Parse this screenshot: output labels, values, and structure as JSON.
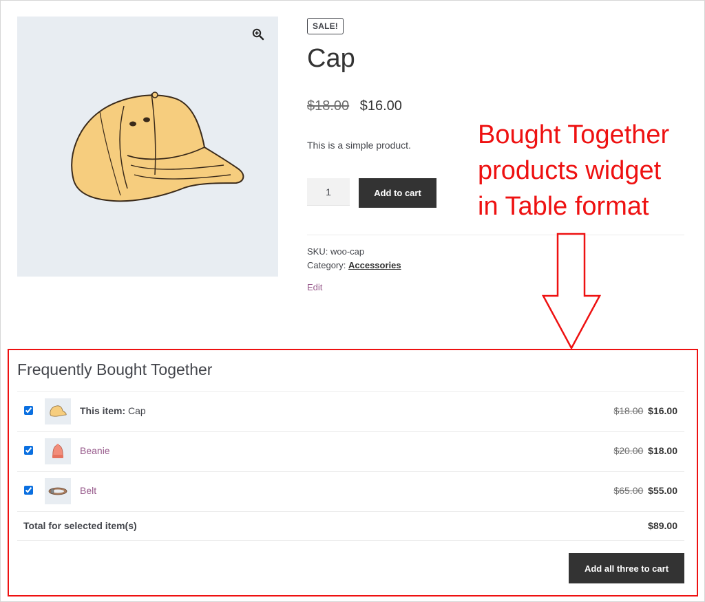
{
  "product": {
    "badge": "SALE!",
    "title": "Cap",
    "price_old": "$18.00",
    "price_new": "$16.00",
    "description": "This is a simple product.",
    "quantity": "1",
    "add_to_cart_label": "Add to cart",
    "sku_label": "SKU:",
    "sku_value": "woo-cap",
    "category_label": "Category:",
    "category_value": "Accessories",
    "edit_label": "Edit",
    "zoom_icon": "zoom-in-icon"
  },
  "annotation": {
    "line1": "Bought Together",
    "line2": "products widget",
    "line3": "in Table format",
    "color": "#ee1111"
  },
  "fbt": {
    "title": "Frequently Bought Together",
    "items": [
      {
        "label": "This item:",
        "name": "Cap",
        "old": "$18.00",
        "new": "$16.00",
        "checked": true
      },
      {
        "label": "",
        "name": "Beanie",
        "old": "$20.00",
        "new": "$18.00",
        "checked": true
      },
      {
        "label": "",
        "name": "Belt",
        "old": "$65.00",
        "new": "$55.00",
        "checked": true
      }
    ],
    "total_label": "Total for selected item(s)",
    "total_value": "$89.00",
    "button_label": "Add all three to cart"
  },
  "colors": {
    "link": "#96588a",
    "button": "#333333",
    "image_bg": "#e8edf2",
    "highlight": "#ee1111"
  }
}
